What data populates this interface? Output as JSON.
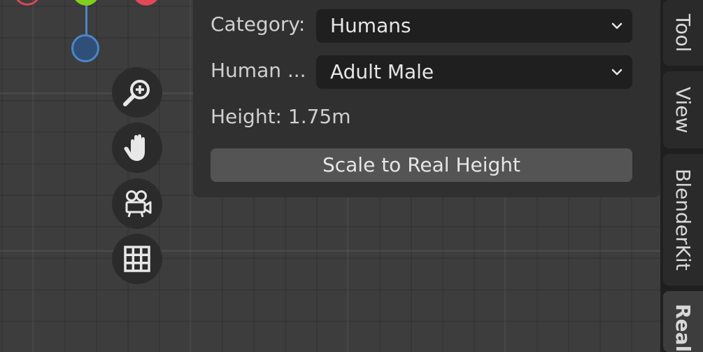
{
  "panel": {
    "category_label": "Category:",
    "category_value": "Humans",
    "human_label": "Human ...",
    "human_value": "Adult Male",
    "height_text": "Height: 1.75m",
    "scale_button": "Scale to Real Height"
  },
  "tabs": [
    {
      "label": "Tool"
    },
    {
      "label": "View"
    },
    {
      "label": "BlenderKit"
    },
    {
      "label": "Real",
      "active": true
    }
  ],
  "colors": {
    "background": "#3d3d3d",
    "panel": "#303030",
    "dropdown": "#1f1f1f",
    "button": "#545454",
    "gizmo_x": "#e5475a",
    "gizmo_y": "#7fcf1c",
    "gizmo_z": "#4a86c8"
  },
  "nav_icons": [
    "zoom-icon",
    "hand-pan-icon",
    "camera-icon",
    "grid-icon"
  ]
}
